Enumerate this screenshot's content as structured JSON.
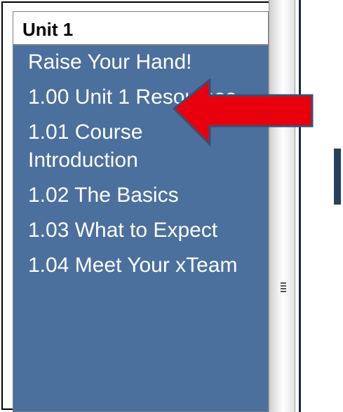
{
  "nav": {
    "header": "Unit 1",
    "items": [
      {
        "label": "Raise Your Hand!"
      },
      {
        "label": "1.00 Unit 1 Resources"
      },
      {
        "label": "1.01 Course Introduction"
      },
      {
        "label": "1.02 The Basics"
      },
      {
        "label": "1.03 What to Expect"
      },
      {
        "label": "1.04 Meet Your xTeam"
      }
    ]
  },
  "colors": {
    "nav_background": "#4b709e",
    "nav_text": "#ffffff",
    "arrow_fill": "#e8000c",
    "arrow_stroke": "#3a4f74"
  },
  "icons": {
    "scroll_grip": "scroll-grip-icon",
    "annotation": "red-left-arrow"
  }
}
